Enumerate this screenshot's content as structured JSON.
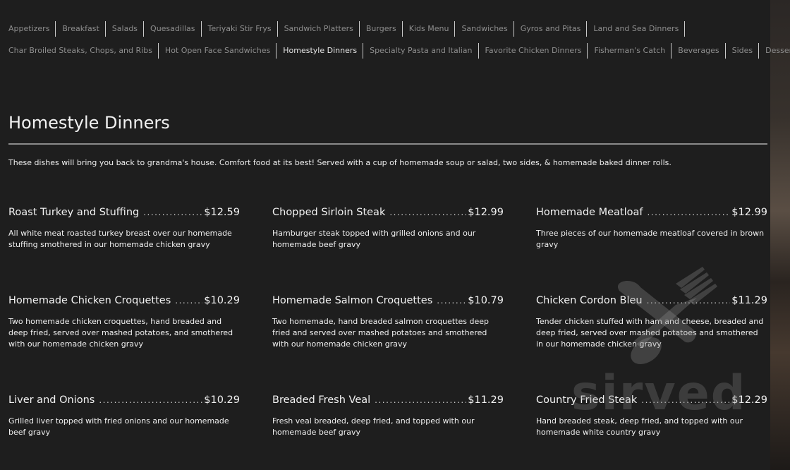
{
  "nav": {
    "row1": [
      "Appetizers",
      "Breakfast",
      "Salads",
      "Quesadillas",
      "Teriyaki Stir Frys",
      "Sandwich Platters",
      "Burgers",
      "Kids Menu",
      "Sandwiches",
      "Gyros and Pitas",
      "Land and Sea Dinners"
    ],
    "row2": [
      "Char Broiled Steaks, Chops, and Ribs",
      "Hot Open Face Sandwiches",
      "Homestyle Dinners",
      "Specialty Pasta and Italian",
      "Favorite Chicken Dinners",
      "Fisherman's Catch",
      "Beverages",
      "Sides",
      "Desserts"
    ],
    "active": "Homestyle Dinners"
  },
  "section": {
    "title": "Homestyle Dinners",
    "intro": "These dishes will bring you back to grandma's house. Comfort food at its best! Served with a cup of homemade soup or salad, two sides, & homemade baked dinner rolls."
  },
  "dishes": [
    {
      "name": "Roast Turkey and Stuffing",
      "price": "$12.59",
      "desc": "All white meat roasted turkey breast over our homemade stuffing smothered in our homemade chicken gravy"
    },
    {
      "name": "Chopped Sirloin Steak",
      "price": "$12.99",
      "desc": "Hamburger steak topped with grilled onions and our homemade beef gravy"
    },
    {
      "name": "Homemade Meatloaf",
      "price": "$12.99",
      "desc": "Three pieces of our homemade meatloaf covered in brown gravy"
    },
    {
      "name": "Homemade Chicken Croquettes",
      "price": "$10.29",
      "desc": "Two homemade chicken croquettes, hand breaded and deep fried, served over mashed potatoes, and smothered with our homemade chicken gravy"
    },
    {
      "name": "Homemade Salmon Croquettes",
      "price": "$10.79",
      "desc": "Two homemade, hand breaded salmon croquettes deep fried and served over mashed potatoes and smothered with our homemade chicken gravy"
    },
    {
      "name": "Chicken Cordon Bleu",
      "price": "$11.29",
      "desc": "Tender chicken stuffed with ham and cheese, breaded and deep fried, served over mashed potatoes and smothered in our homemade chicken gravy"
    },
    {
      "name": "Liver and Onions",
      "price": "$10.29",
      "desc": "Grilled liver topped with fried onions and our homemade beef gravy"
    },
    {
      "name": "Breaded Fresh Veal",
      "price": "$11.29",
      "desc": "Fresh veal breaded, deep fried, and topped with our homemade beef gravy"
    },
    {
      "name": "Country Fried Steak",
      "price": "$12.29",
      "desc": "Hand breaded steak, deep fried, and topped with our homemade white country gravy"
    }
  ],
  "watermark": {
    "text": "sirved",
    "icon": "fork-spoon-icon"
  }
}
